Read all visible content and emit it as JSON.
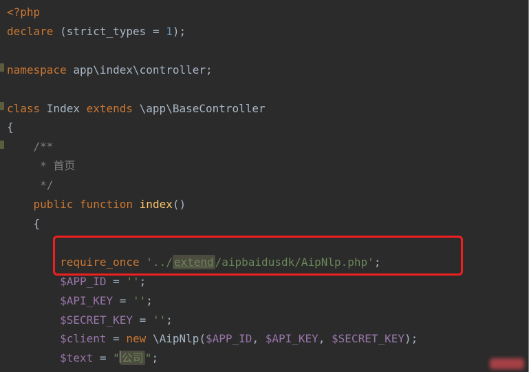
{
  "code": {
    "l1_a": "<?",
    "l1_b": "php",
    "l2_a": "declare",
    "l2_b": " (strict_types ",
    "l2_c": "= ",
    "l2_d": "1",
    "l2_e": ");",
    "l3": "",
    "l4_a": "namespace ",
    "l4_b": "app\\index\\controller",
    "l4_c": ";",
    "l5": "",
    "l6_a": "class ",
    "l6_b": "Index ",
    "l6_c": "extends ",
    "l6_d": "\\app\\",
    "l6_e": "BaseController",
    "l7": "{",
    "l8": "    /**",
    "l9": "     * 首页",
    "l10": "     */",
    "l11_a": "    ",
    "l11_b": "public ",
    "l11_c": "function ",
    "l11_d": "index",
    "l11_e": "()",
    "l12": "    {",
    "l13": "",
    "l14_a": "        ",
    "l14_b": "require_once ",
    "l14_c": "'../",
    "l14_d": "extend",
    "l14_e": "/aipbaidusdk/AipNlp.php'",
    "l14_f": ";",
    "l15_a": "        ",
    "l15_b": "$APP_ID",
    "l15_c": " = ",
    "l15_d": "''",
    "l15_e": ";",
    "l16_a": "        ",
    "l16_b": "$API_KEY",
    "l16_c": " = ",
    "l16_d": "''",
    "l16_e": ";",
    "l17_a": "        ",
    "l17_b": "$SECRET_KEY",
    "l17_c": " = ",
    "l17_d": "''",
    "l17_e": ";",
    "l18_a": "        ",
    "l18_b": "$client",
    "l18_c": " = ",
    "l18_d": "new ",
    "l18_e": "\\AipNlp(",
    "l18_f": "$APP_ID",
    "l18_g": ", ",
    "l18_h": "$API_KEY",
    "l18_i": ", ",
    "l18_j": "$SECRET_KEY",
    "l18_k": ");",
    "l19_a": "        ",
    "l19_b": "$text",
    "l19_c": " = ",
    "l19_d": "\"",
    "l19_e": "公司",
    "l19_f": "\"",
    "l19_g": ";"
  }
}
